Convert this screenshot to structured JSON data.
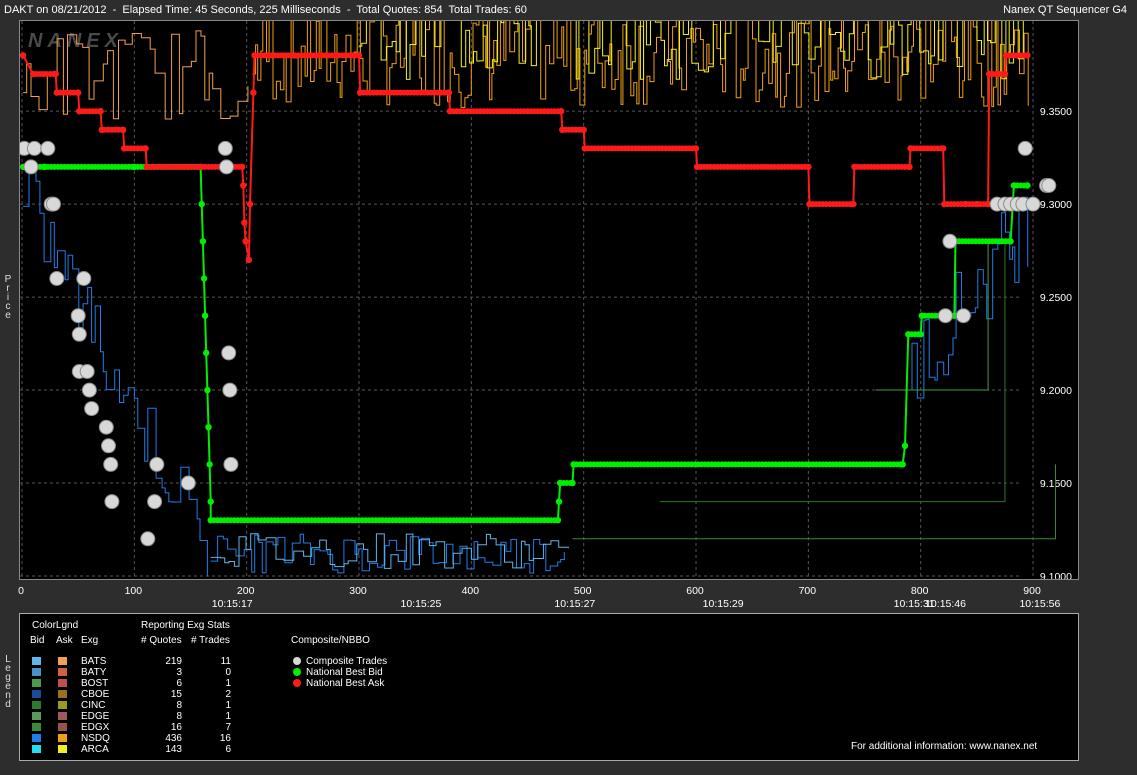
{
  "header": {
    "left": "DAKT on 08/21/2012  -  Elapsed Time: 45 Seconds, 225 Milliseconds  -  Total Quotes: 854  Total Trades: 60",
    "right": "Nanex QT Sequencer G4"
  },
  "watermark": "NANEX",
  "y_axis_title": "Price",
  "legend_side_title": "Legend",
  "footer_info": "For additional information: www.nanex.net",
  "colors": {
    "background": "#000000",
    "frame": "#2d2d2d",
    "best_bid": "#00ee00",
    "best_ask": "#ff1a1a",
    "trade": "#d8d8d8",
    "grid": "#555555"
  },
  "chart_data": {
    "type": "line",
    "xlim": [
      0,
      924
    ],
    "ylim": [
      9.0973,
      9.3985
    ],
    "y_ticks": [
      "9.1000",
      "9.1500",
      "9.2000",
      "9.2500",
      "9.3000",
      "9.3500"
    ],
    "x_ticks": [
      "0",
      "100",
      "200",
      "300",
      "400",
      "500",
      "600",
      "700",
      "800",
      "900"
    ],
    "time_labels": [
      {
        "x": 188,
        "label": "10:15:17"
      },
      {
        "x": 356,
        "label": "10:15:25"
      },
      {
        "x": 493,
        "label": "10:15:27"
      },
      {
        "x": 625,
        "label": "10:15:29"
      },
      {
        "x": 795,
        "label": "10:15:31"
      },
      {
        "x": 823,
        "label": "10:15:46"
      },
      {
        "x": 907,
        "label": "10:15:56"
      }
    ],
    "grid": true,
    "series": [
      {
        "name": "National Best Bid",
        "color": "#00ee00",
        "points": [
          [
            1,
            9.32
          ],
          [
            20,
            9.32
          ],
          [
            20,
            9.32
          ],
          [
            100,
            9.32
          ],
          [
            100,
            9.32
          ],
          [
            159,
            9.32
          ],
          [
            160,
            9.3
          ],
          [
            161,
            9.28
          ],
          [
            162,
            9.26
          ],
          [
            163,
            9.24
          ],
          [
            164,
            9.22
          ],
          [
            165,
            9.2
          ],
          [
            166,
            9.18
          ],
          [
            167,
            9.16
          ],
          [
            168,
            9.14
          ],
          [
            168,
            9.13
          ],
          [
            477,
            9.13
          ],
          [
            478,
            9.14
          ],
          [
            479,
            9.15
          ],
          [
            490,
            9.15
          ],
          [
            491,
            9.16
          ],
          [
            784,
            9.16
          ],
          [
            786,
            9.17
          ],
          [
            789,
            9.23
          ],
          [
            800,
            9.23
          ],
          [
            801,
            9.24
          ],
          [
            830,
            9.24
          ],
          [
            831,
            9.28
          ],
          [
            880,
            9.28
          ],
          [
            882,
            9.3
          ],
          [
            883,
            9.31
          ],
          [
            895,
            9.31
          ]
        ]
      },
      {
        "name": "National Best Ask",
        "color": "#ff1a1a",
        "points": [
          [
            1,
            9.38
          ],
          [
            10,
            9.37
          ],
          [
            30,
            9.37
          ],
          [
            31,
            9.36
          ],
          [
            50,
            9.36
          ],
          [
            51,
            9.35
          ],
          [
            70,
            9.35
          ],
          [
            71,
            9.34
          ],
          [
            90,
            9.34
          ],
          [
            91,
            9.33
          ],
          [
            110,
            9.33
          ],
          [
            111,
            9.32
          ],
          [
            159,
            9.32
          ],
          [
            160,
            9.32
          ],
          [
            196,
            9.32
          ],
          [
            197,
            9.31
          ],
          [
            198,
            9.29
          ],
          [
            199,
            9.28
          ],
          [
            202,
            9.27
          ],
          [
            203,
            9.3
          ],
          [
            206,
            9.36
          ],
          [
            207,
            9.38
          ],
          [
            300,
            9.38
          ],
          [
            301,
            9.36
          ],
          [
            380,
            9.36
          ],
          [
            381,
            9.35
          ],
          [
            480,
            9.35
          ],
          [
            481,
            9.34
          ],
          [
            500,
            9.34
          ],
          [
            501,
            9.33
          ],
          [
            600,
            9.33
          ],
          [
            601,
            9.32
          ],
          [
            700,
            9.32
          ],
          [
            701,
            9.3
          ],
          [
            740,
            9.3
          ],
          [
            741,
            9.32
          ],
          [
            790,
            9.32
          ],
          [
            791,
            9.33
          ],
          [
            820,
            9.33
          ],
          [
            821,
            9.3
          ],
          [
            840,
            9.3
          ],
          [
            850,
            9.3
          ],
          [
            860,
            9.3
          ],
          [
            861,
            9.37
          ],
          [
            875,
            9.37
          ],
          [
            876,
            9.38
          ],
          [
            895,
            9.38
          ]
        ]
      }
    ],
    "trades": [
      [
        2,
        9.33
      ],
      [
        8,
        9.32
      ],
      [
        11,
        9.33
      ],
      [
        23,
        9.33
      ],
      [
        26,
        9.3
      ],
      [
        28,
        9.3
      ],
      [
        31,
        9.26
      ],
      [
        50,
        9.24
      ],
      [
        51,
        9.23
      ],
      [
        51,
        9.21
      ],
      [
        55,
        9.26
      ],
      [
        58,
        9.21
      ],
      [
        60,
        9.2
      ],
      [
        62,
        9.19
      ],
      [
        75,
        9.18
      ],
      [
        77,
        9.17
      ],
      [
        79,
        9.16
      ],
      [
        80,
        9.14
      ],
      [
        112,
        9.12
      ],
      [
        118,
        9.14
      ],
      [
        120,
        9.16
      ],
      [
        148,
        9.15
      ],
      [
        181,
        9.33
      ],
      [
        182,
        9.32
      ],
      [
        184,
        9.22
      ],
      [
        185,
        9.2
      ],
      [
        186,
        9.16
      ],
      [
        822,
        9.24
      ],
      [
        826,
        9.28
      ],
      [
        838,
        9.24
      ],
      [
        868,
        9.3
      ],
      [
        875,
        9.3
      ],
      [
        880,
        9.3
      ],
      [
        886,
        9.3
      ],
      [
        891,
        9.3
      ],
      [
        893,
        9.33
      ],
      [
        900,
        9.3
      ],
      [
        912,
        9.31
      ],
      [
        914,
        9.31
      ]
    ]
  },
  "legend": {
    "headers": {
      "colorlgnd": "ColorLgnd",
      "bid": "Bid",
      "ask": "Ask",
      "exg": "Exg",
      "stats": "Reporting Exg Stats",
      "quotes": "# Quotes",
      "trades": "# Trades",
      "composite": "Composite/NBBO"
    },
    "rows": [
      {
        "exg": "BATS",
        "quotes": "219",
        "trades": "11",
        "bid_color": "#5fb6e8",
        "ask_color": "#f0a050"
      },
      {
        "exg": "BATY",
        "quotes": "3",
        "trades": "0",
        "bid_color": "#4a90c8",
        "ask_color": "#d06040"
      },
      {
        "exg": "BOST",
        "quotes": "6",
        "trades": "1",
        "bid_color": "#4a9a4a",
        "ask_color": "#c05050"
      },
      {
        "exg": "CBOE",
        "quotes": "15",
        "trades": "2",
        "bid_color": "#1a4a9a",
        "ask_color": "#9a7020"
      },
      {
        "exg": "CINC",
        "quotes": "8",
        "trades": "1",
        "bid_color": "#2a7a2a",
        "ask_color": "#9a9a20"
      },
      {
        "exg": "EDGE",
        "quotes": "8",
        "trades": "1",
        "bid_color": "#5a9a5a",
        "ask_color": "#a05a5a"
      },
      {
        "exg": "EDGX",
        "quotes": "16",
        "trades": "7",
        "bid_color": "#3a8a3a",
        "ask_color": "#9a5050"
      },
      {
        "exg": "NSDQ",
        "quotes": "436",
        "trades": "16",
        "bid_color": "#1e7ee6",
        "ask_color": "#f0a010"
      },
      {
        "exg": "ARCA",
        "quotes": "143",
        "trades": "6",
        "bid_color": "#20e0f0",
        "ask_color": "#f0f020"
      }
    ],
    "composite": [
      {
        "label": "Composite Trades",
        "color": "#d8d8d8"
      },
      {
        "label": "National Best Bid",
        "color": "#00ee00"
      },
      {
        "label": "National Best Ask",
        "color": "#ff1a1a"
      }
    ]
  }
}
